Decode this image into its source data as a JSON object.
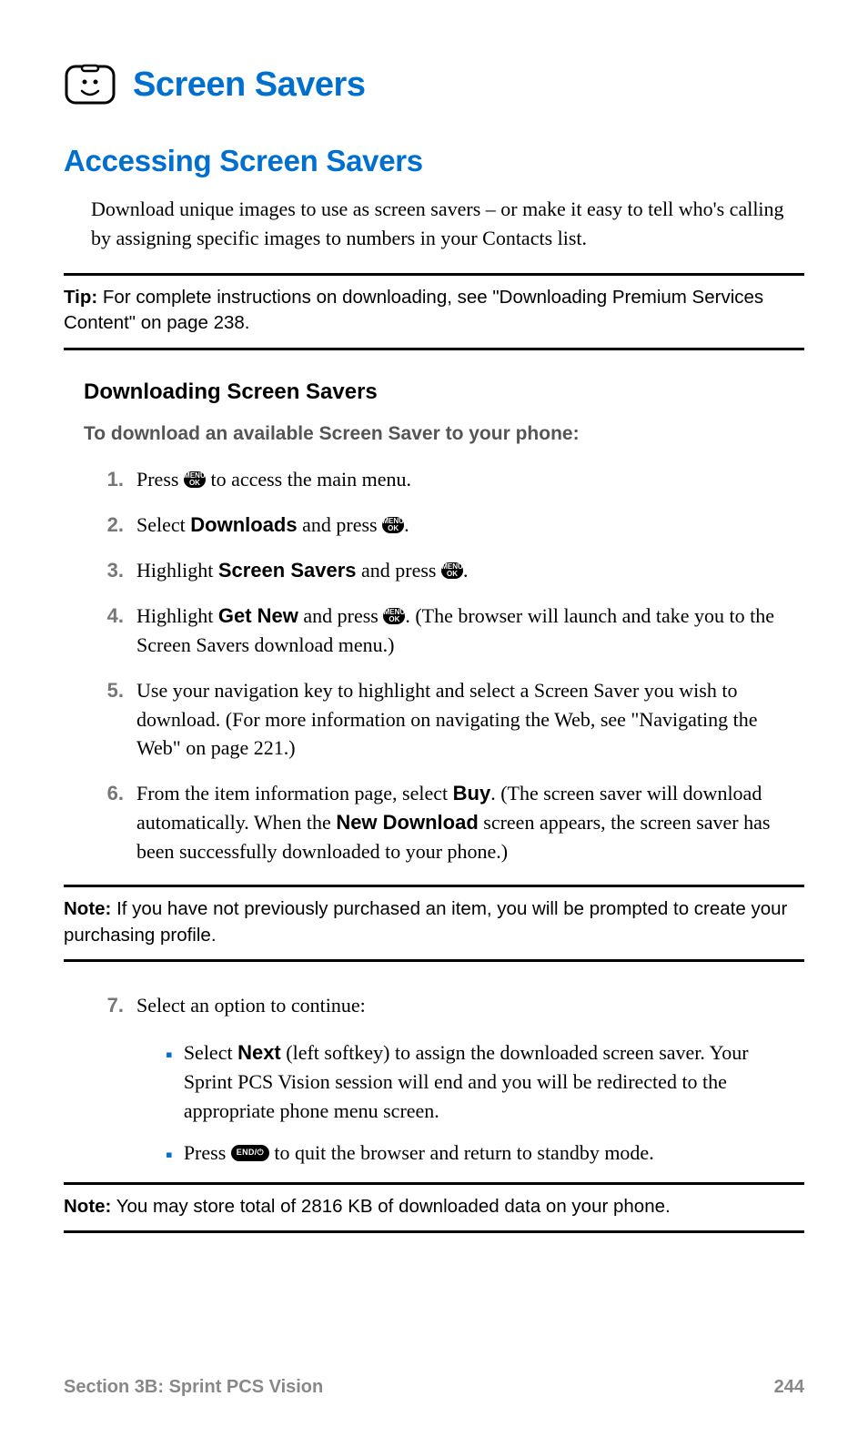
{
  "title": "Screen Savers",
  "section_heading": "Accessing Screen Savers",
  "intro": "Download unique images to use as screen savers – or make it easy to tell who's calling by assigning specific images to numbers in your Contacts list.",
  "tip_label": "Tip:",
  "tip_text": " For complete instructions on downloading, see \"Downloading Premium Services Content\" on page 238.",
  "sub_heading": "Downloading Screen Savers",
  "lead": "To download an available Screen Saver to your phone:",
  "menu_top": "MENU",
  "menu_bot": "OK",
  "end_label": "END/⏻",
  "steps": {
    "s1": {
      "num": "1.",
      "a": "Press ",
      "b": " to access the main menu."
    },
    "s2": {
      "num": "2.",
      "a": "Select ",
      "bold": "Downloads",
      "b": " and press ",
      "c": "."
    },
    "s3": {
      "num": "3.",
      "a": "Highlight ",
      "bold": "Screen Savers",
      "b": " and press ",
      "c": "."
    },
    "s4": {
      "num": "4.",
      "a": "Highlight ",
      "bold": "Get New",
      "b": " and press ",
      "c": ". (The browser will launch and take you to the Screen Savers download menu.)"
    },
    "s5": {
      "num": "5.",
      "a": "Use your navigation key to highlight and select a Screen Saver you wish to download. (For more information on navigating the Web, see \"Navigating the Web\" on page 221.)"
    },
    "s6": {
      "num": "6.",
      "a": "From the item information page, select ",
      "bold1": "Buy",
      "b": ". (The screen saver will download automatically. When the ",
      "bold2": "New Download",
      "c": " screen appears, the screen saver has been successfully downloaded to your phone.)"
    },
    "s7": {
      "num": "7.",
      "a": "Select an option to continue:"
    }
  },
  "note1_label": "Note:",
  "note1_text": " If you have not previously purchased an item, you will be prompted to create your purchasing profile.",
  "bullets": {
    "b1": {
      "a": "Select ",
      "bold": "Next",
      "b": " (left softkey) to assign the downloaded screen saver. Your Sprint PCS Vision session will end and you will be redirected to the appropriate phone menu screen."
    },
    "b2": {
      "a": "Press ",
      "b": " to quit the browser and return to standby mode."
    }
  },
  "note2_label": "Note:",
  "note2_text": " You may store total of 2816 KB of downloaded data on your phone.",
  "footer_left": "Section 3B: Sprint PCS Vision",
  "footer_right": "244"
}
